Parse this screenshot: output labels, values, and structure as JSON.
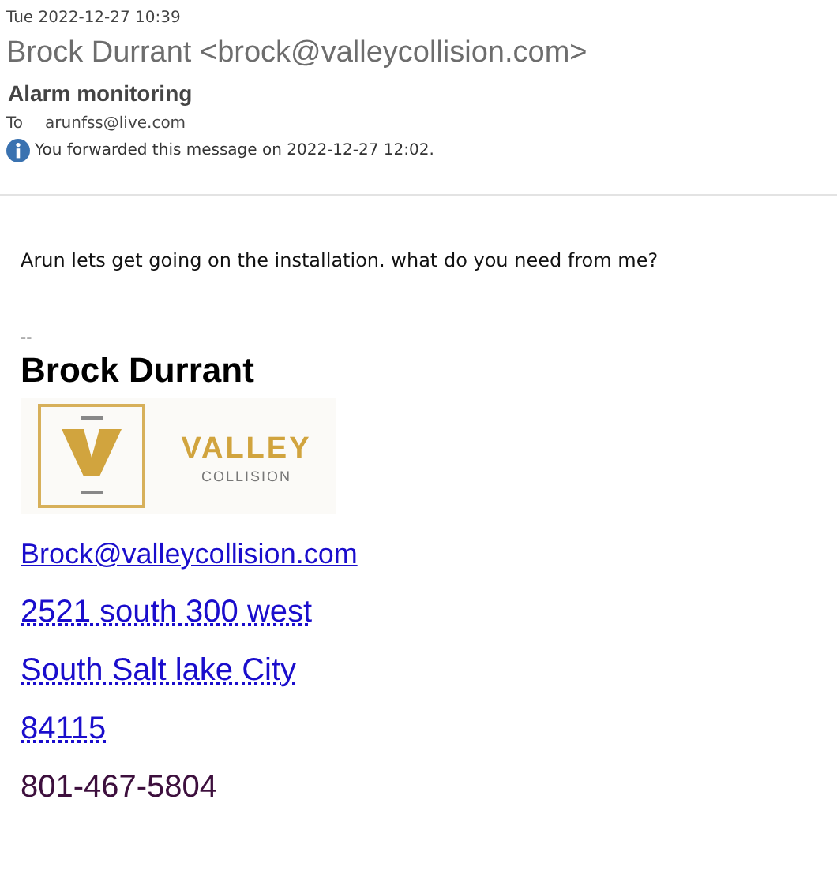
{
  "header": {
    "date": "Tue 2022-12-27 10:39",
    "from": "Brock Durrant <brock@valleycollision.com>",
    "subject": "Alarm monitoring",
    "to_label": "To",
    "to": "arunfss@live.com",
    "info": "You forwarded this message on 2022-12-27 12:02."
  },
  "body": {
    "message": "Arun lets get going on the installation. what do you need from me?",
    "separator": "--"
  },
  "signature": {
    "name": "Brock Durrant",
    "logo": {
      "name": "VALLEY",
      "sub": "COLLISION"
    },
    "lines": [
      {
        "kind": "email",
        "text": "Brock@valleycollision.com"
      },
      {
        "kind": "address",
        "text": "2521 south 300 west"
      },
      {
        "kind": "address",
        "text": "South Salt lake City"
      },
      {
        "kind": "address",
        "text": "84115"
      },
      {
        "kind": "phone",
        "text": "801-467-5804"
      }
    ]
  }
}
